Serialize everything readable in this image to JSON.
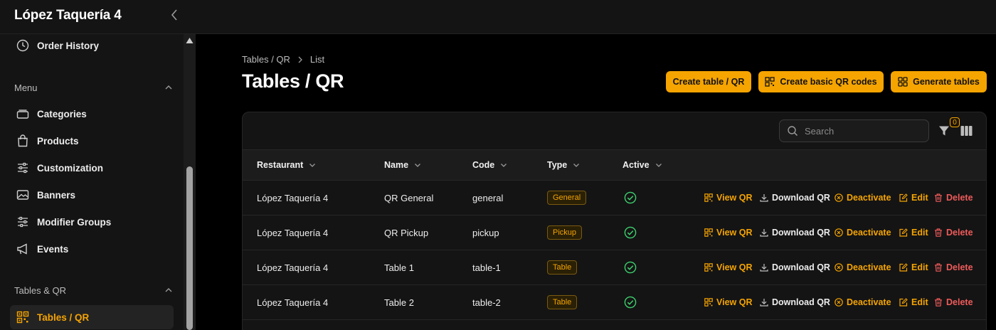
{
  "app": {
    "title": "López Taquería 4"
  },
  "sidebar": {
    "order_history": "Order History",
    "menu_section": "Menu",
    "menu_items": [
      "Categories",
      "Products",
      "Customization",
      "Banners",
      "Modifier Groups",
      "Events"
    ],
    "tables_section": "Tables & QR",
    "tables_items": [
      "Tables / QR"
    ]
  },
  "breadcrumb": {
    "parent": "Tables / QR",
    "current": "List"
  },
  "page": {
    "title": "Tables / QR"
  },
  "buttons": {
    "create_table": "Create table / QR",
    "create_basic_qr": "Create basic QR codes",
    "generate_tables": "Generate tables"
  },
  "toolbar": {
    "search_placeholder": "Search",
    "filter_count": "0"
  },
  "table": {
    "headers": [
      "Restaurant",
      "Name",
      "Code",
      "Type",
      "Active"
    ],
    "actions": {
      "view_qr": "View QR",
      "download_qr": "Download QR",
      "deactivate": "Deactivate",
      "edit": "Edit",
      "delete": "Delete"
    },
    "rows": [
      {
        "restaurant": "López Taquería 4",
        "name": "QR General",
        "code": "general",
        "type": "General"
      },
      {
        "restaurant": "López Taquería 4",
        "name": "QR Pickup",
        "code": "pickup",
        "type": "Pickup"
      },
      {
        "restaurant": "López Taquería 4",
        "name": "Table 1",
        "code": "table-1",
        "type": "Table"
      },
      {
        "restaurant": "López Taquería 4",
        "name": "Table 2",
        "code": "table-2",
        "type": "Table"
      }
    ]
  },
  "colors": {
    "accent": "#f5a400",
    "danger": "#ef5a5a",
    "success": "#3ecf6e"
  }
}
